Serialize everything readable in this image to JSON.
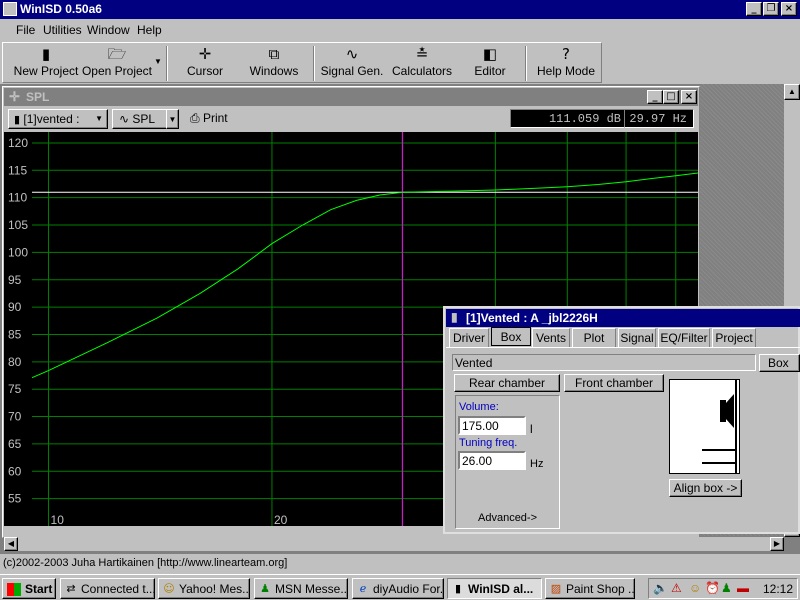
{
  "app": {
    "title": "WinISD  0.50a6"
  },
  "menu": [
    "File",
    "Utilities",
    "Window",
    "Help"
  ],
  "toolbar": [
    {
      "label": "New Project",
      "icon": "new-project-icon",
      "glyph": "▮"
    },
    {
      "label": "Open Project",
      "icon": "open-folder-icon",
      "glyph": "🗁"
    },
    {
      "label": "Cursor",
      "icon": "cursor-icon",
      "glyph": "✛"
    },
    {
      "label": "Windows",
      "icon": "windows-icon",
      "glyph": "⧉"
    },
    {
      "label": "Signal Gen.",
      "icon": "signal-gen-icon",
      "glyph": "∿"
    },
    {
      "label": "Calculators",
      "icon": "calculators-icon",
      "glyph": "≛"
    },
    {
      "label": "Editor",
      "icon": "editor-icon",
      "glyph": "◧"
    },
    {
      "label": "Help Mode",
      "icon": "help-icon",
      "glyph": "?"
    }
  ],
  "spl": {
    "title": "SPL",
    "project_select": "[1]vented :",
    "graph_select": "SPL",
    "print_label": "Print",
    "readout_db": "111.059 dB",
    "readout_hz": "29.97 Hz"
  },
  "chart_data": {
    "type": "line",
    "xscale": "log",
    "xlim": [
      9.5,
      75
    ],
    "ylim": [
      50,
      122
    ],
    "yticks": [
      55,
      60,
      65,
      70,
      75,
      80,
      85,
      90,
      95,
      100,
      105,
      110,
      115,
      120
    ],
    "xtick_labels": [
      {
        "value": 10,
        "label": "10"
      },
      {
        "value": 20,
        "label": "20"
      }
    ],
    "cursor_x": 29.97,
    "reference_y": 111,
    "grid": true,
    "colors": {
      "curve": "#00ff00",
      "grid": "#008000",
      "cursor": "#ff00ff",
      "reference": "#ffffff",
      "axis_text": "#c0c0c0"
    },
    "series": [
      {
        "values": [
          [
            9.5,
            77.1
          ],
          [
            10,
            78.4
          ],
          [
            12,
            83.5
          ],
          [
            14,
            88.0
          ],
          [
            16,
            92.5
          ],
          [
            18,
            97.0
          ],
          [
            20,
            101.6
          ],
          [
            22,
            105.0
          ],
          [
            24,
            107.8
          ],
          [
            26,
            109.5
          ],
          [
            28,
            110.5
          ],
          [
            30,
            111.0
          ],
          [
            35,
            111.2
          ],
          [
            40,
            111.4
          ],
          [
            45,
            111.7
          ],
          [
            50,
            112.0
          ],
          [
            55,
            112.4
          ],
          [
            60,
            112.9
          ],
          [
            65,
            113.5
          ],
          [
            70,
            114.0
          ],
          [
            75,
            114.5
          ]
        ]
      }
    ]
  },
  "box": {
    "title": "[1]Vented : A _jbl2226H",
    "tabs": [
      "Driver",
      "Box",
      "Vents",
      "Plot",
      "Signal",
      "EQ/Filter",
      "Project"
    ],
    "active_tab": "Box",
    "type_value": "Vented",
    "type_btn": "Box",
    "rear_chamber": "Rear chamber",
    "front_chamber": "Front chamber",
    "volume_label": "Volume:",
    "volume_value": "175.00",
    "volume_unit": "l",
    "tuning_label": "Tuning freq.",
    "tuning_value": "26.00",
    "tuning_unit": "Hz",
    "advanced": "Advanced->",
    "align": "Align box ->"
  },
  "status": "(c)2002-2003 Juha Hartikainen [http://www.linearteam.org]",
  "taskbar": {
    "start": "Start",
    "tasks": [
      {
        "label": "Connected t...",
        "icon": "network-icon",
        "glyph": "⇄"
      },
      {
        "label": "Yahoo! Mes...",
        "icon": "yahoo-smiley-icon",
        "glyph": "☺"
      },
      {
        "label": "MSN Messe...",
        "icon": "msn-icon",
        "glyph": "♟"
      },
      {
        "label": "diyAudio For...",
        "icon": "ie-icon",
        "glyph": "ℯ"
      },
      {
        "label": "WinISD  al...",
        "icon": "winisd-icon",
        "glyph": "▮"
      },
      {
        "label": "Paint Shop ...",
        "icon": "paintshop-icon",
        "glyph": "▨"
      }
    ],
    "clock": "12:12"
  }
}
